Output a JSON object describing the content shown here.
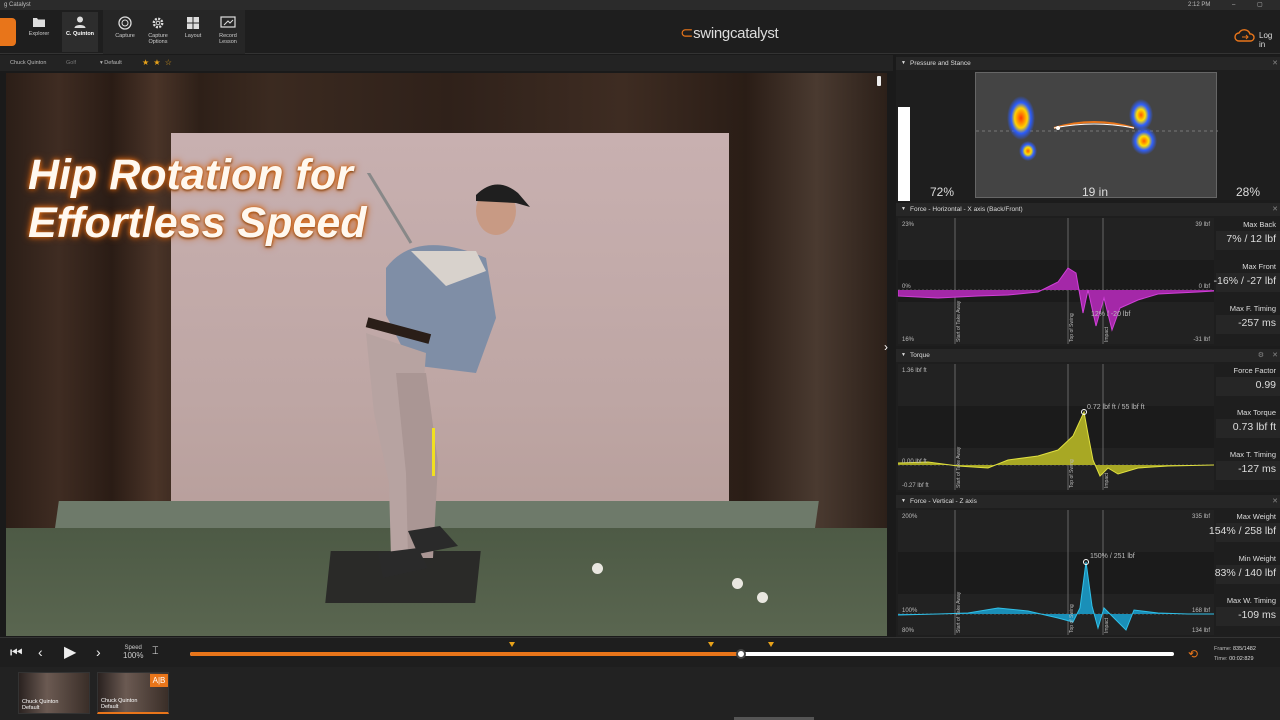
{
  "titlebar": {
    "title": "g Catalyst",
    "time": "2:12 PM"
  },
  "toolbar": {
    "buttons": [
      {
        "label": "Explorer",
        "icon": "folder-icon"
      },
      {
        "label": "C. Quinton",
        "icon": "user-icon"
      },
      {
        "label": "Capture",
        "icon": "capture-icon"
      },
      {
        "label": "Capture Options",
        "icon": "gear-icon"
      },
      {
        "label": "Layout",
        "icon": "grid-icon"
      },
      {
        "label": "Record Lesson",
        "icon": "record-lesson-icon"
      }
    ],
    "brand_prefix": "swing",
    "brand_suffix": "catalyst",
    "login": "Log in"
  },
  "subbar": {
    "player": "Chuck Quinton",
    "sport": "Golf",
    "preset": "Default",
    "stars": "★ ★ ☆"
  },
  "video": {
    "title_line1": "Hip Rotation for",
    "title_line2": "Effortless Speed"
  },
  "pressure": {
    "title": "Pressure and Stance",
    "left_pct": "72%",
    "width": "19 in",
    "right_pct": "28%"
  },
  "force_x": {
    "title": "Force - Horizontal - X axis (Back/Front)",
    "top_left": "23%",
    "top_right": "39 lbf",
    "mid_left": "0%",
    "mid_right": "0 lbf",
    "bot_left": "16%",
    "bot_right": "-31 lbf",
    "events": [
      "Start of Take Away",
      "Top of Swing",
      "Impact"
    ],
    "annotation": "12% / -20 lbf",
    "stats": [
      {
        "label": "Max Back",
        "value": "7% / 12 lbf"
      },
      {
        "label": "Max Front",
        "value": "-16% / -27 lbf"
      },
      {
        "label": "Max F. Timing",
        "value": "-257 ms"
      }
    ]
  },
  "torque": {
    "title": "Torque",
    "top_left": "1.36 lbf ft",
    "mid_left": "0.00 lbf ft",
    "bot_left": "-0.27 lbf ft",
    "events": [
      "Start of Take Away",
      "Top of Swing",
      "Impact"
    ],
    "annotation": "0.72 lbf ft / 55 lbf ft",
    "stats": [
      {
        "label": "Force Factor",
        "value": "0.99"
      },
      {
        "label": "Max Torque",
        "value": "0.73 lbf ft"
      },
      {
        "label": "Max T. Timing",
        "value": "-127 ms"
      }
    ]
  },
  "force_z": {
    "title": "Force - Vertical - Z axis",
    "top_left": "200%",
    "top_right": "335 lbf",
    "mid_left": "100%",
    "mid_right": "168 lbf",
    "bot_left": "80%",
    "bot_right": "134 lbf",
    "events": [
      "Start of Take Away",
      "Top of Swing",
      "Impact"
    ],
    "annotation": "150% / 251 lbf",
    "stats": [
      {
        "label": "Max Weight",
        "value": "154% / 258 lbf"
      },
      {
        "label": "Min Weight",
        "value": "83% / 140 lbf"
      },
      {
        "label": "Max W. Timing",
        "value": "-109 ms"
      }
    ]
  },
  "playback": {
    "speed_label": "Speed",
    "speed_value": "100%",
    "frame_label": "Frame:",
    "frame_value": "835/1482",
    "time_label": "Time:",
    "time_value": "00:02:829",
    "progress": 0.56
  },
  "tray": {
    "clips": [
      {
        "name": "Chuck Quinton",
        "preset": "Default"
      },
      {
        "name": "Chuck Quinton",
        "preset": "Default"
      }
    ],
    "ab_label": "A|B"
  },
  "colors": {
    "accent": "#e8751a",
    "force_x": "#b02ab5",
    "torque": "#c8c82a",
    "force_z": "#1fa0c8"
  }
}
